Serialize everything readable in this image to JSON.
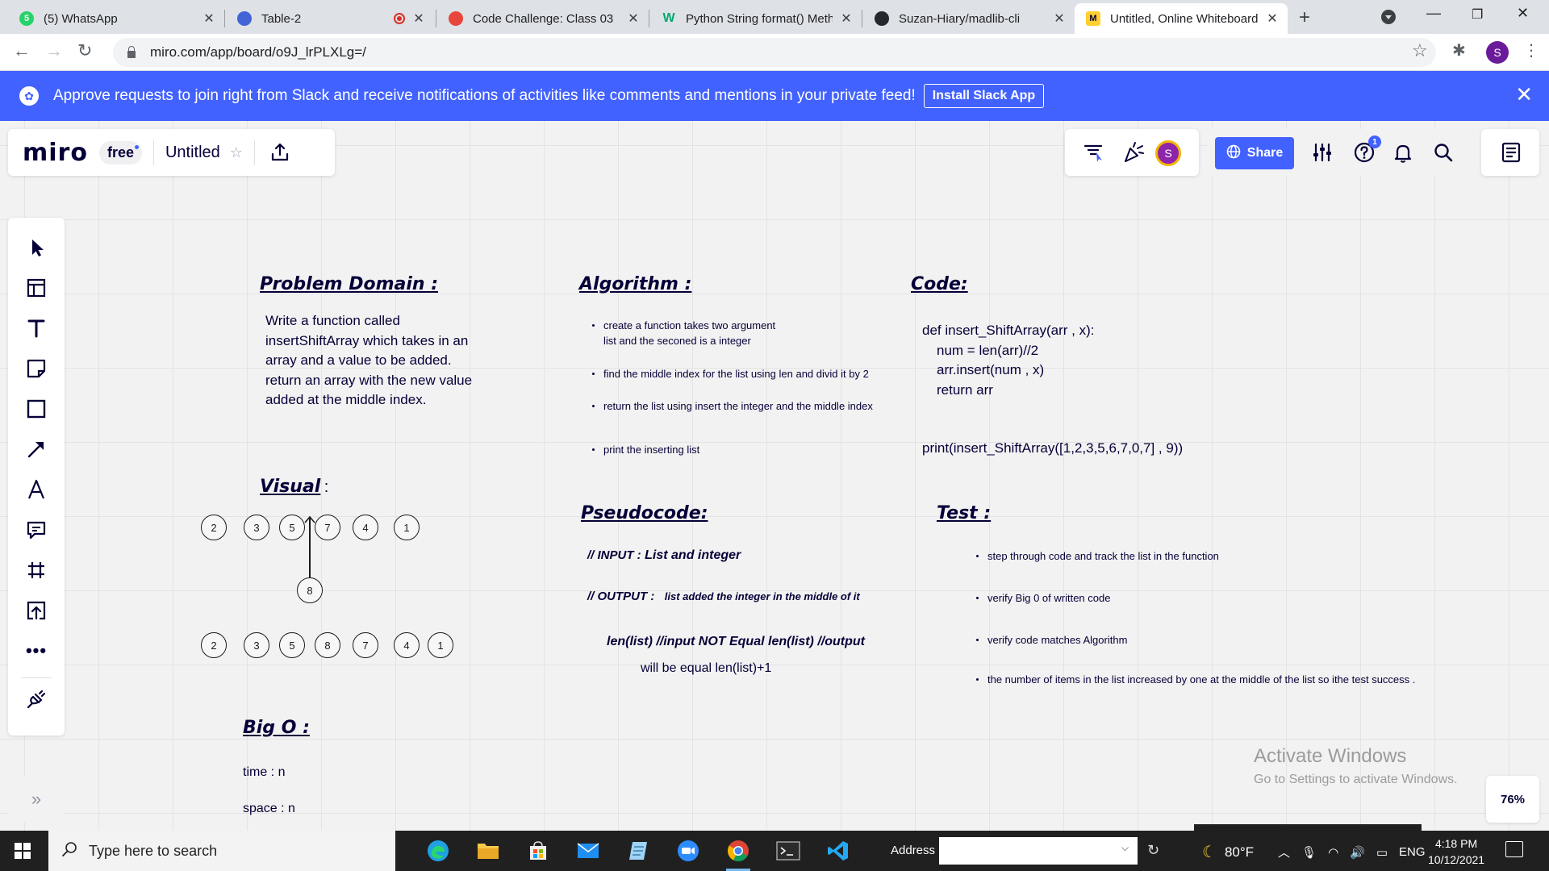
{
  "browser": {
    "tabs": [
      {
        "title": "(5) WhatsApp",
        "favicon_color": "#25d366",
        "favicon_text": "5"
      },
      {
        "title": "Table-2",
        "favicon_color": "#4264d6",
        "favicon_text": ""
      },
      {
        "title": "Code Challenge: Class 03",
        "favicon_color": "#e8453c",
        "favicon_text": ""
      },
      {
        "title": "Python String format() Meth",
        "favicon_color": "#04aa6d",
        "favicon_text": "W"
      },
      {
        "title": "Suzan-Hiary/madlib-cli",
        "favicon_color": "#24292e",
        "favicon_text": ""
      },
      {
        "title": "Untitled, Online Whiteboard",
        "favicon_color": "#ffd02f",
        "favicon_text": "M"
      }
    ],
    "url": "miro.com/app/board/o9J_lrPLXLg=/",
    "profile_initial": "S"
  },
  "banner": {
    "message": "Approve requests to join right from Slack and receive notifications of activities like comments and mentions in your private feed!",
    "button": "Install Slack App"
  },
  "miro": {
    "logo": "miro",
    "plan": "free",
    "board_title": "Untitled",
    "share_label": "Share",
    "collaborator_initial": "S",
    "help_badge_count": "1",
    "zoom": "76%"
  },
  "board": {
    "problem_domain": {
      "heading": "Problem Domain :",
      "text": "Write a function called insertShiftArray which takes in an array and a value to be added.  return an array with the new value added at the middle index."
    },
    "algorithm": {
      "heading": "Algorithm :",
      "items": [
        "create a function takes two argument\nlist and the seconed is a integer",
        "find the middle index for the list using len and divid it by 2",
        "return the list  using insert the integer and the middle index",
        "print the inserting list"
      ]
    },
    "code": {
      "heading": "Code:",
      "lines": [
        "def insert_ShiftArray(arr , x):",
        "num = len(arr)//2",
        "arr.insert(num , x)",
        "return arr"
      ],
      "print_line": "print(insert_ShiftArray([1,2,3,5,6,7,0,7] , 9))"
    },
    "visual": {
      "heading": "Visual",
      "suffix": ":",
      "row1": [
        "2",
        "3",
        "5",
        "7",
        "4",
        "1"
      ],
      "inserted": "8",
      "row2": [
        "2",
        "3",
        "5",
        "8",
        "7",
        "4",
        "1"
      ]
    },
    "pseudocode": {
      "heading": "Pseudocode:",
      "input_label": "// INPUT :",
      "input_value": "List and integer",
      "output_label": "// OUTPUT :",
      "output_value": "list added the integer in the middle of it",
      "condition": "len(list) //input NOT Equal len(list) //output",
      "result": "will be equal len(list)+1"
    },
    "test": {
      "heading": "Test :",
      "items": [
        "step through code and track the list in the function",
        "verify Big 0 of written code",
        "verify code matches Algorithm",
        "the number of items in the list  increased by one at the middle of the list so ithe test success ."
      ]
    },
    "big_o": {
      "heading": "Big O :",
      "time": "time : n",
      "space": "space : n"
    }
  },
  "watermark": {
    "line1": "Activate Windows",
    "line2": "Go to Settings to activate Windows."
  },
  "taskbar": {
    "search_placeholder": "Type here to search",
    "address_label": "Address",
    "temperature": "80°F",
    "language": "ENG",
    "time": "4:18 PM",
    "date": "10/12/2021"
  }
}
